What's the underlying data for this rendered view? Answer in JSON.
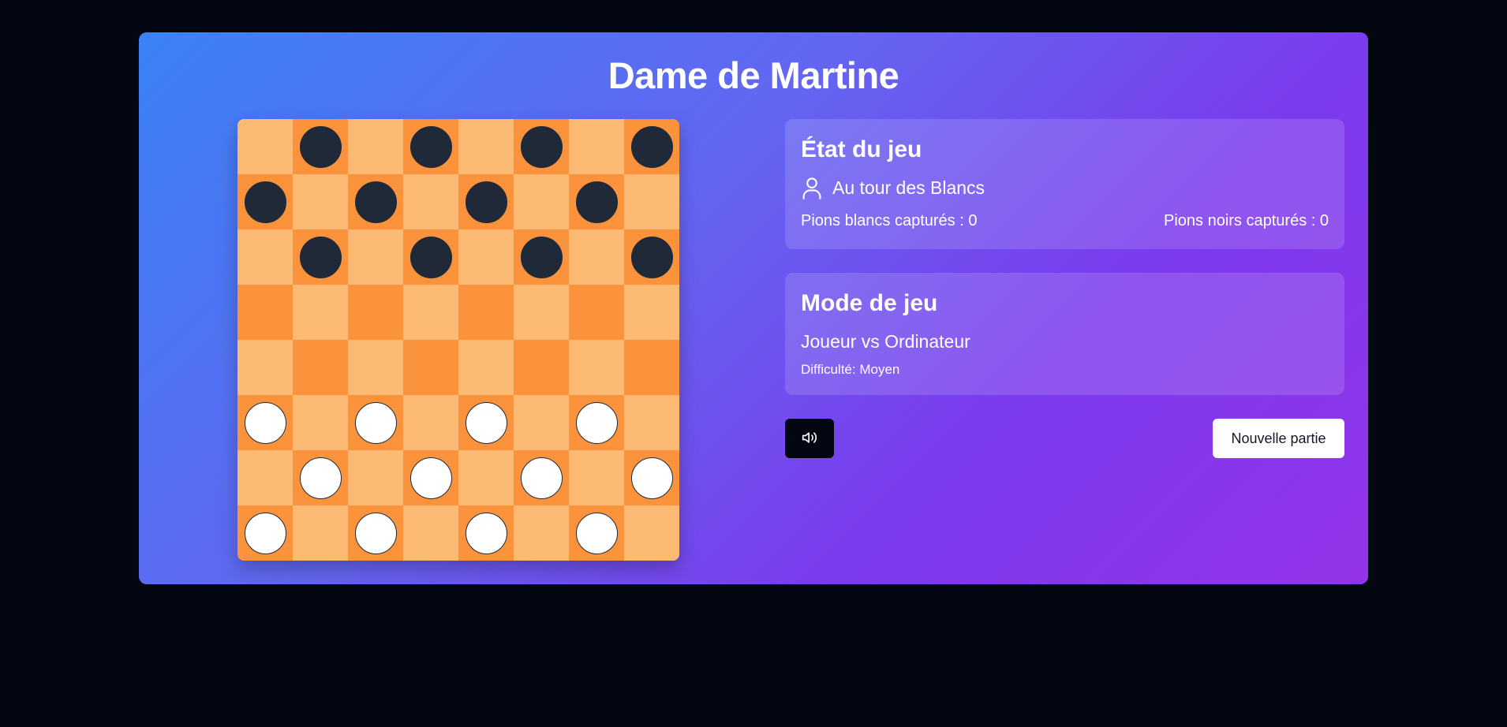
{
  "app": {
    "title": "Dame de Martine",
    "background_color": "#030712",
    "accent_gradient": [
      "#3b82f6",
      "#6366f1",
      "#7c3aed",
      "#9333ea"
    ]
  },
  "board": {
    "size": 8,
    "light_square_color": "#fdba74",
    "dark_square_color": "#fb923c",
    "black_piece_color": "#1f2937",
    "white_piece_color": "#ffffff",
    "rows": [
      "-b-b-b-b",
      "b-b-b-b-",
      "-b-b-b-b",
      "--------",
      "--------",
      "w-w-w-w-",
      "-w-w-w-w",
      "w-w-w-w-"
    ]
  },
  "game_state": {
    "heading": "État du jeu",
    "icon": "user-icon",
    "turn_text": "Au tour des Blancs",
    "white_captured": "Pions blancs capturés : 0",
    "black_captured": "Pions noirs capturés : 0"
  },
  "game_mode": {
    "heading": "Mode de jeu",
    "mode": "Joueur vs Ordinateur",
    "difficulty": "Difficulté: Moyen"
  },
  "controls": {
    "sound_icon": "speaker-icon",
    "new_game_label": "Nouvelle partie"
  }
}
